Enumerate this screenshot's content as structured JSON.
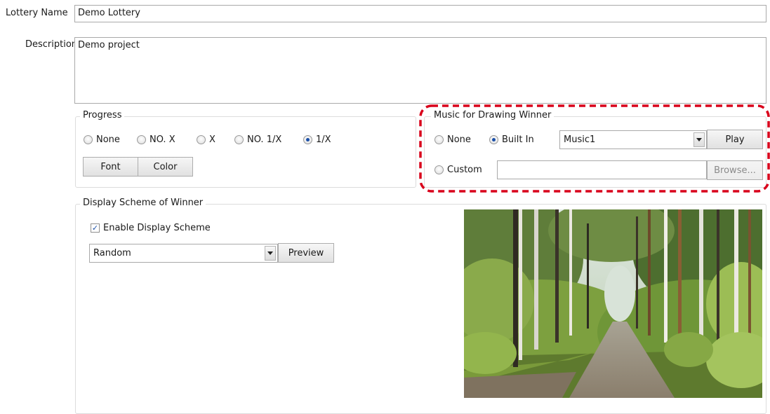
{
  "fields": {
    "lottery_name_label": "Lottery Name",
    "lottery_name_value": "Demo Lottery",
    "description_label": "Description",
    "description_value": "Demo project"
  },
  "progress": {
    "title": "Progress",
    "options": [
      "None",
      "NO. X",
      "X",
      "NO. 1/X",
      "1/X"
    ],
    "selected": "1/X",
    "font_label": "Font",
    "color_label": "Color"
  },
  "music": {
    "title": "Music for Drawing Winner",
    "none_label": "None",
    "builtin_label": "Built In",
    "custom_label": "Custom",
    "selected": "Built In",
    "music_value": "Music1",
    "play_label": "Play",
    "custom_path": "",
    "browse_label": "Browse...",
    "highlight_color": "#d9001b"
  },
  "display": {
    "title": "Display Scheme of Winner",
    "enable_label": "Enable Display Scheme",
    "enable_checked": true,
    "scheme_value": "Random",
    "preview_label": "Preview",
    "image_alt": "forest-path-photo"
  }
}
